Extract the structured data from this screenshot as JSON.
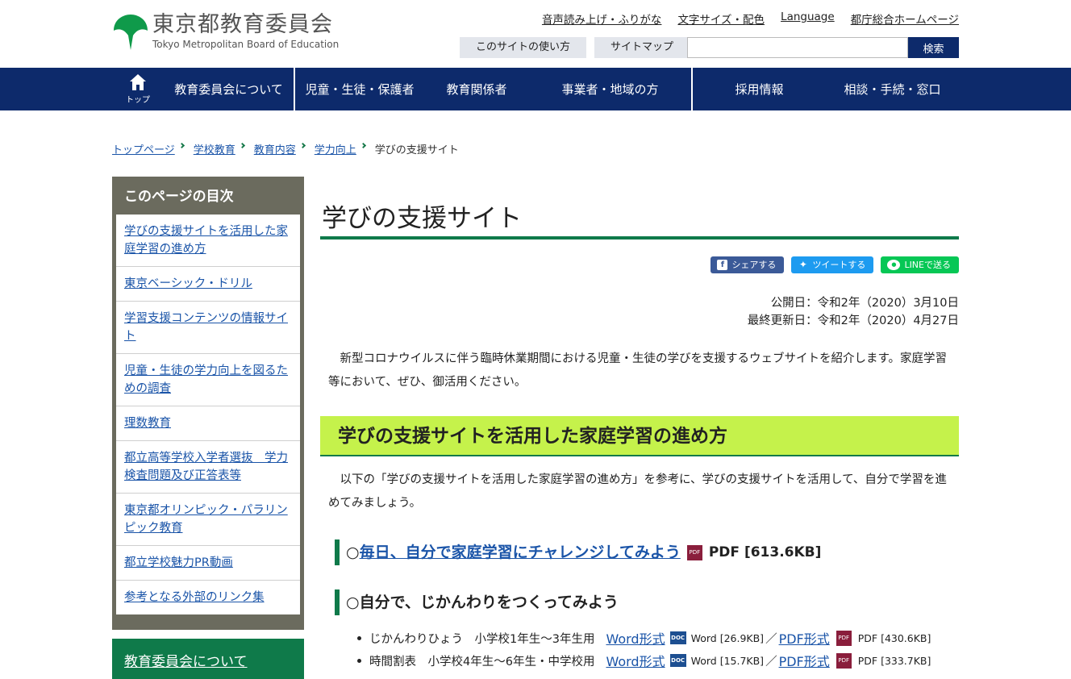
{
  "header": {
    "logo_ja": "東京都教育委員会",
    "logo_en": "Tokyo Metropolitan Board of Education",
    "util_links": [
      "音声読み上げ・ふりがな",
      "文字サイズ・配色",
      "Language",
      "都庁総合ホームページ"
    ],
    "sub_buttons": [
      "このサイトの使い方",
      "サイトマップ"
    ],
    "search_placeholder": "",
    "search_button": "検索"
  },
  "gnav": {
    "home_label": "トップ",
    "items": [
      "教育委員会について",
      "児童・生徒・保護者",
      "教育関係者",
      "事業者・地域の方",
      "採用情報",
      "相談・手続・窓口"
    ]
  },
  "breadcrumb": {
    "links": [
      "トップページ",
      "学校教育",
      "教育内容",
      "学力向上"
    ],
    "current": "学びの支援サイト"
  },
  "sidebar": {
    "toc_title": "このページの目次",
    "toc_items": [
      "学びの支援サイトを活用した家庭学習の進め方",
      "東京ベーシック・ドリル",
      "学習支援コンテンツの情報サイト",
      "児童・生徒の学力向上を図るための調査",
      "理数教育",
      "都立高等学校入学者選抜　学力検査問題及び正答表等",
      "東京都オリンピック・パラリンピック教育",
      "都立学校魅力PR動画",
      "参考となる外部のリンク集"
    ],
    "section_link": "教育委員会について"
  },
  "main": {
    "title": "学びの支援サイト",
    "share": {
      "facebook": "シェアする",
      "twitter": "ツイートする",
      "line": "LINEで送る"
    },
    "published": "公開日：令和2年（2020）3月10日",
    "updated": "最終更新日：令和2年（2020）4月27日",
    "intro": "新型コロナウイルスに伴う臨時休業期間における児童・生徒の学びを支援するウェブサイトを紹介します。家庭学習等において、ぜひ、御活用ください。",
    "section_heading": "学びの支援サイトを活用した家庭学習の進め方",
    "section_text": "以下の「学びの支援サイトを活用した家庭学習の進め方」を参考に、学びの支援サイトを活用して、自分で学習を進めてみましょう。",
    "h3a": {
      "prefix": "○",
      "link": "毎日、自分で家庭学習にチャレンジしてみよう",
      "icon": "PDF",
      "size": "PDF [613.6KB]"
    },
    "h3b": "○自分で、じかんわりをつくってみよう",
    "files": [
      {
        "label": "じかんわりひょう　小学校1年生～3年生用",
        "word_link": "Word形式",
        "word_size": "Word [26.9KB]",
        "pdf_link": "PDF形式",
        "pdf_size": "PDF [430.6KB]"
      },
      {
        "label": "時間割表　小学校4年生～6年生・中学校用",
        "word_link": "Word形式",
        "word_size": "Word [15.7KB]",
        "pdf_link": "PDF形式",
        "pdf_size": "PDF [333.7KB]"
      }
    ],
    "icons": {
      "doc": "DOC",
      "pdf": "PDF",
      "slash": "／"
    }
  },
  "colors": {
    "nav_navy": "#0d2a6b",
    "brand_green": "#0f7a4a",
    "heading_lime": "#c5f24b",
    "toc_gray": "#6b6b5e",
    "link_blue": "#1a54a8"
  }
}
